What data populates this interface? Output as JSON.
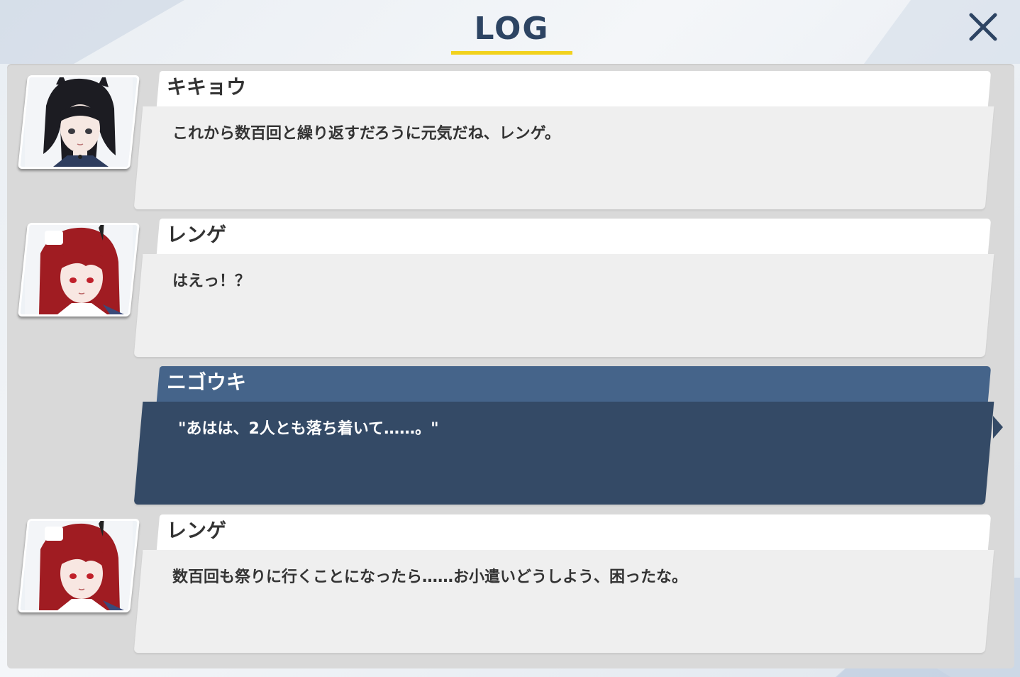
{
  "header": {
    "title": "LOG",
    "close_label": "×"
  },
  "log": [
    {
      "speaker": "キキョウ",
      "text": "これから数百回と繰り返すだろうに元気だね、レンゲ。",
      "avatar": "kikyou-portrait",
      "is_player": false
    },
    {
      "speaker": "レンゲ",
      "text": "はえっ！？",
      "avatar": "renge-portrait",
      "is_player": false
    },
    {
      "speaker": "ニゴウキ",
      "text": "\"あはは、2人とも落ち着いて……。\"",
      "avatar": "",
      "is_player": true
    },
    {
      "speaker": "レンゲ",
      "text": "数百回も祭りに行くことになったら……お小遣いどうしよう、困ったな。",
      "avatar": "renge-portrait",
      "is_player": false
    }
  ],
  "colors": {
    "title": "#2d4463",
    "underline": "#f2d21d",
    "player_name_bg": "#45648a",
    "player_msg_bg": "#344a66"
  }
}
